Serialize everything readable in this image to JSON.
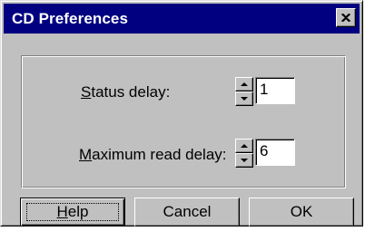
{
  "window": {
    "title": "CD Preferences",
    "close_glyph": "✕"
  },
  "fields": {
    "status_delay": {
      "label_mnemonic": "S",
      "label_rest": "tatus delay:",
      "value": "1"
    },
    "max_read_delay": {
      "label_mnemonic": "M",
      "label_rest": "aximum read delay:",
      "value": "6"
    }
  },
  "buttons": {
    "help_mnemonic": "H",
    "help_rest": "elp",
    "cancel": "Cancel",
    "ok": "OK"
  },
  "colors": {
    "title_bar": "#000080",
    "face": "#c0c0c0"
  }
}
